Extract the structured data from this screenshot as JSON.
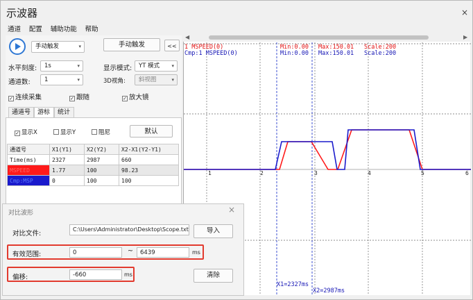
{
  "window": {
    "title": "示波器",
    "close": "×"
  },
  "menu": [
    "通道",
    "配置",
    "辅助功能",
    "帮助"
  ],
  "toolbar": {
    "trigger_mode": "手动触发",
    "manual_trigger_button": "手动触发",
    "collapse_button": "<<"
  },
  "settings": {
    "h_scale_label": "水平刻度:",
    "h_scale_value": "1s",
    "display_mode_label": "显示模式:",
    "display_mode_value": "YT 模式",
    "channels_label": "通道数:",
    "channels_value": "1",
    "view3d_label": "3D视角:",
    "view3d_value": "斜视图",
    "continuous_label": "连续采集",
    "follow_label": "跟随",
    "magnifier_label": "放大镜"
  },
  "tabs": [
    "通道号",
    "游标",
    "统计"
  ],
  "cursor_tab": {
    "show_x": "显示X",
    "show_y": "显示Y",
    "damping": "阻尼",
    "default_button": "默认"
  },
  "table": {
    "headers": [
      "通道号",
      "X1(Y1)",
      "X2(Y2)",
      "X2-X1(Y2-Y1)"
    ],
    "rows": [
      {
        "name": "Time(ms)",
        "x1": "2327",
        "x2": "2987",
        "dx": "660",
        "color": ""
      },
      {
        "name": "MSPEED",
        "x1": "1.77",
        "x2": "100",
        "dx": "98.23",
        "color": "#ff1a1a"
      },
      {
        "name": "Cmp:MSP",
        "x1": "0",
        "x2": "100",
        "dx": "100",
        "color": "#1a1acc"
      }
    ]
  },
  "scope": {
    "line1": "1 MSPEED(0)",
    "line1_min": "Min:0.00",
    "line1_max": "Max:150.01",
    "line1_scale": "Scale:200",
    "line2": "Cmp:1 MSPEED(0)",
    "line2_min": "Min:0.00",
    "line2_max": "Max:150.01",
    "line2_scale": "Scale:200",
    "x_ticks": [
      "1",
      "2",
      "3",
      "4",
      "5",
      "6"
    ],
    "cursor1_label": "X1=2327ms",
    "cursor2_label": "X2=2987ms",
    "colors": {
      "series": "#ff1a1a",
      "compare": "#1a1acc"
    }
  },
  "dialog": {
    "title": "对比波形",
    "close": "×",
    "file_label": "对比文件:",
    "file_path": "C:\\Users\\Administrator\\Desktop\\Scope.txt",
    "import_button": "导入",
    "range_label": "有效范围:",
    "range_from": "0",
    "range_sep": "~",
    "range_to": "6439",
    "range_unit": "ms",
    "offset_label": "偏移:",
    "offset_value": "-660",
    "offset_unit": "ms",
    "clear_button": "清除"
  }
}
